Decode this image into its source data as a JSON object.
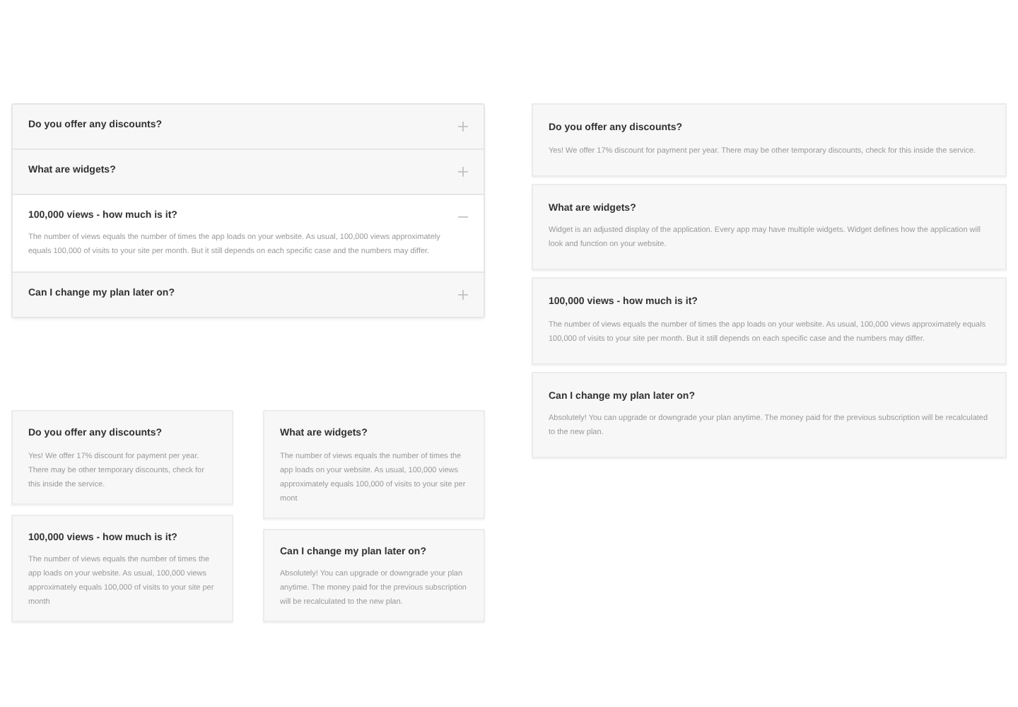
{
  "accordion": {
    "items": [
      {
        "question": "Do you offer any discounts?",
        "expanded": false
      },
      {
        "question": "What are widgets?",
        "expanded": false
      },
      {
        "question": "100,000 views - how much is it?",
        "expanded": true,
        "answer": "The number of views equals the number of times the app loads on your website. As usual, 100,000 views approximately equals 100,000 of visits to your site per month. But it still depends on  each specific case and the numbers may differ."
      },
      {
        "question": "Can I change my plan later on?",
        "expanded": false
      }
    ]
  },
  "list": {
    "items": [
      {
        "question": "Do you offer any discounts?",
        "answer": "Yes! We offer 17% discount for payment per year. There may be other temporary discounts, check for this inside the service."
      },
      {
        "question": "What are widgets?",
        "answer": "Widget is an adjusted display of the application. Every app may have multiple widgets. Widget defines how the application will look and function on your website."
      },
      {
        "question": "100,000 views - how much is it?",
        "answer": "The number of views equals the number of times the app loads on your website. As usual, 100,000 views approximately equals 100,000 of visits to your site per month. But it still depends on  each specific case and the numbers may differ."
      },
      {
        "question": "Can I change my plan later on?",
        "answer": "Absolutely! You can upgrade or downgrade your plan anytime. The money paid for the previous subscription will be recalculated to the new plan."
      }
    ]
  },
  "grid": {
    "columns": [
      {
        "items": [
          {
            "question": "Do you offer any discounts?",
            "answer": "Yes! We offer 17% discount for payment per year. There may be other temporary discounts, check for this inside the service."
          },
          {
            "question": "100,000 views - how much is it?",
            "answer": "The number of views equals the number of times the app loads on your website. As usual, 100,000 views approximately equals 100,000 of visits to your site per month"
          }
        ]
      },
      {
        "items": [
          {
            "question": "What are widgets?",
            "answer": "The number of views equals the number of times the app loads on your website. As usual, 100,000 views approximately equals 100,000 of visits to your site per mont"
          },
          {
            "question": "Can I change my plan later on?",
            "answer": "Absolutely! You can upgrade or downgrade your plan anytime. The money paid for the previous subscription will be recalculated to the new plan."
          }
        ]
      }
    ]
  }
}
